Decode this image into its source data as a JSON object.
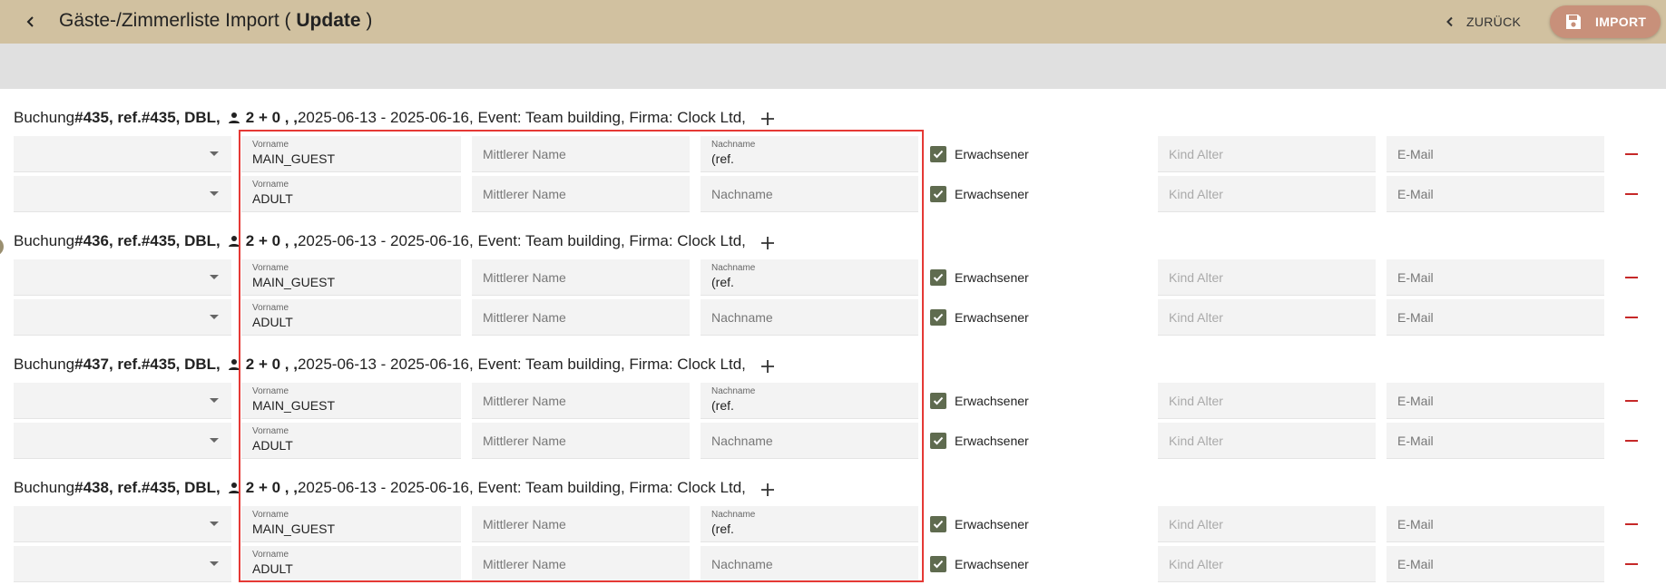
{
  "header": {
    "title_prefix": "Gäste-/Zimmerliste Import ( ",
    "title_mode": "Update",
    "title_suffix": " )",
    "back_label": "ZURÜCK",
    "import_label": "IMPORT"
  },
  "labels": {
    "vorname": "Vorname",
    "mittlerer_name": "Mittlerer Name",
    "nachname": "Nachname",
    "erwachsener": "Erwachsener",
    "kind_alter": "Kind Alter",
    "email": "E-Mail"
  },
  "bookings": [
    {
      "prefix": "Buchung ",
      "bold": "#435, ref.#435, DBL,",
      "persons": "2 + 0 , ,",
      "details": " 2025-06-13 - 2025-06-16, Event: Team building, Firma: Clock Ltd,",
      "guests": [
        {
          "vorname": "MAIN_GUEST",
          "nachname": "(ref.",
          "erwachsener": true
        },
        {
          "vorname": "ADULT",
          "nachname": "",
          "erwachsener": true
        }
      ]
    },
    {
      "prefix": "Buchung ",
      "bold": "#436, ref.#435, DBL,",
      "persons": "2 + 0 , ,",
      "details": " 2025-06-13 - 2025-06-16, Event: Team building, Firma: Clock Ltd,",
      "guests": [
        {
          "vorname": "MAIN_GUEST",
          "nachname": "(ref.",
          "erwachsener": true
        },
        {
          "vorname": "ADULT",
          "nachname": "",
          "erwachsener": true
        }
      ]
    },
    {
      "prefix": "Buchung ",
      "bold": "#437, ref.#435, DBL,",
      "persons": "2 + 0 , ,",
      "details": " 2025-06-13 - 2025-06-16, Event: Team building, Firma: Clock Ltd,",
      "guests": [
        {
          "vorname": "MAIN_GUEST",
          "nachname": "(ref.",
          "erwachsener": true
        },
        {
          "vorname": "ADULT",
          "nachname": "",
          "erwachsener": true
        }
      ]
    },
    {
      "prefix": "Buchung ",
      "bold": "#438, ref.#435, DBL,",
      "persons": "2 + 0 , ,",
      "details": " 2025-06-13 - 2025-06-16, Event: Team building, Firma: Clock Ltd,",
      "guests": [
        {
          "vorname": "MAIN_GUEST",
          "nachname": "(ref.",
          "erwachsener": true
        },
        {
          "vorname": "ADULT",
          "nachname": "",
          "erwachsener": true
        }
      ]
    }
  ],
  "colors": {
    "header_bg": "#d1c1a0",
    "import_button": "#c8907a",
    "checkbox": "#5f6b4f",
    "remove_icon": "#c62828",
    "highlight": "#e53935"
  },
  "icons": {
    "back": "chevron-left-icon",
    "save": "floppy-disk-icon",
    "person": "person-icon",
    "add": "plus-icon",
    "remove": "minus-icon",
    "dropdown": "caret-down-icon",
    "check": "check-icon"
  }
}
